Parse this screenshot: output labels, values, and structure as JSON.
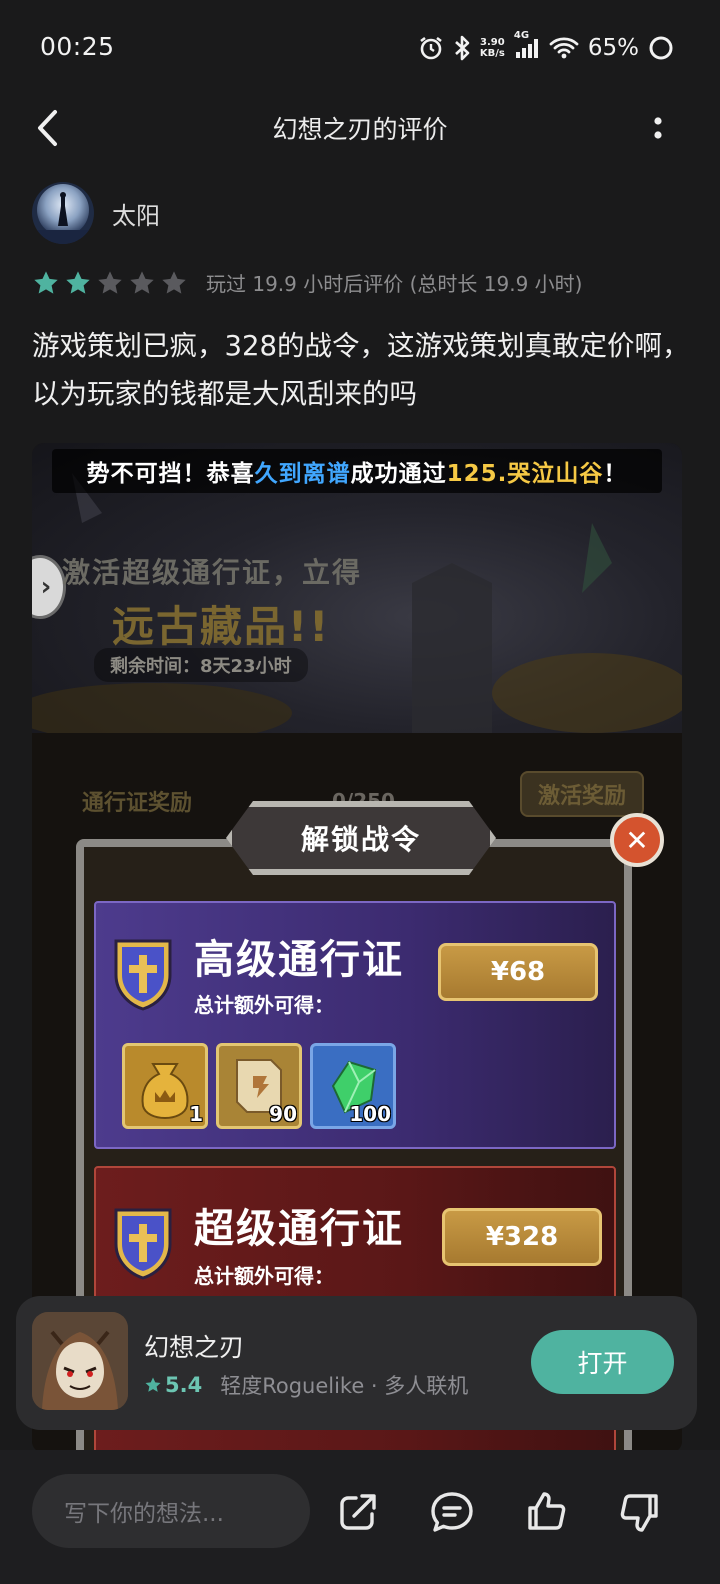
{
  "status_bar": {
    "time": "00:25",
    "net_speed_value": "3.90",
    "net_speed_unit": "KB/s",
    "network": "4G",
    "battery": "65%"
  },
  "header": {
    "title": "幻想之刃的评价"
  },
  "review": {
    "author": "太阳",
    "stars_filled": 2,
    "stars_total": 5,
    "playtime": "玩过 19.9 小时后评价 (总时长 19.9 小时)",
    "text": "游戏策划已疯，328的战令，这游戏策划真敢定价啊，以为玩家的钱都是大风刮来的吗"
  },
  "screenshot": {
    "banner_pre": "势不可挡！恭喜",
    "banner_player": "久到离谱",
    "banner_mid": "成功通过",
    "banner_stage": "125.哭泣山谷",
    "banner_post": "！",
    "promo_line1": "激活超级通行证，立得",
    "promo_line2": "远古藏品!!",
    "promo_time": "剩余时间：8天23小时",
    "tab_left": "通行证奖励",
    "progress": "0/250",
    "tab_right": "激活奖励",
    "panel_title": "解锁战令",
    "pass_advanced": {
      "name": "高级通行证",
      "sub": "总计额外可得：",
      "price": "¥68",
      "rewards": [
        {
          "item": "gold-bag",
          "qty": "1"
        },
        {
          "item": "scroll",
          "qty": "90"
        },
        {
          "item": "green-gem",
          "qty": "100"
        }
      ]
    },
    "pass_super": {
      "name": "超级通行证",
      "sub": "总计额外可得：",
      "price": "¥328"
    }
  },
  "game_card": {
    "name": "幻想之刃",
    "score": "5.4",
    "tags": "轻度Roguelike · 多人联机",
    "open_label": "打开"
  },
  "bottom_bar": {
    "input_placeholder": "写下你的想法..."
  },
  "colors": {
    "accent": "#4fb3a0",
    "star_filled": "#4fb3a0",
    "star_empty": "#5a5a5e",
    "background": "#1a1a1b"
  }
}
